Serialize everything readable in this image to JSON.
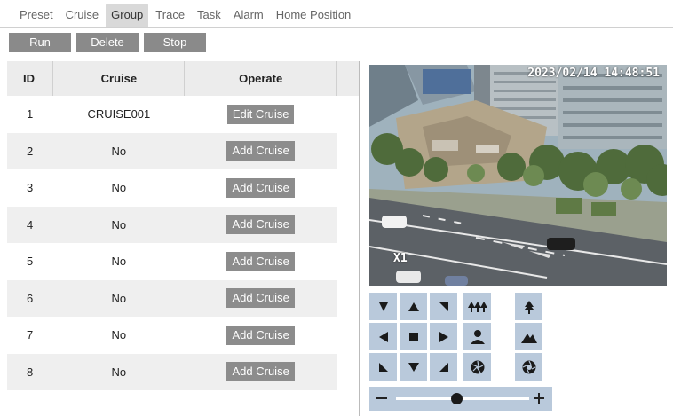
{
  "tabs": [
    {
      "label": "Preset"
    },
    {
      "label": "Cruise"
    },
    {
      "label": "Group",
      "active": true
    },
    {
      "label": "Trace"
    },
    {
      "label": "Task"
    },
    {
      "label": "Alarm"
    },
    {
      "label": "Home Position"
    }
  ],
  "toolbar": {
    "run": "Run",
    "delete": "Delete",
    "stop": "Stop"
  },
  "table": {
    "headers": {
      "id": "ID",
      "cruise": "Cruise",
      "operate": "Operate"
    },
    "rows": [
      {
        "id": "1",
        "cruise": "CRUISE001",
        "action": "Edit Cruise"
      },
      {
        "id": "2",
        "cruise": "No",
        "action": "Add Cruise"
      },
      {
        "id": "3",
        "cruise": "No",
        "action": "Add Cruise"
      },
      {
        "id": "4",
        "cruise": "No",
        "action": "Add Cruise"
      },
      {
        "id": "5",
        "cruise": "No",
        "action": "Add Cruise"
      },
      {
        "id": "6",
        "cruise": "No",
        "action": "Add Cruise"
      },
      {
        "id": "7",
        "cruise": "No",
        "action": "Add Cruise"
      },
      {
        "id": "8",
        "cruise": "No",
        "action": "Add Cruise"
      }
    ]
  },
  "video": {
    "timestamp": "2023/02/14 14:48:51",
    "zoom": "X1"
  },
  "ptz": {
    "directions": [
      "up-left",
      "up",
      "up-right",
      "left",
      "stop",
      "right",
      "down-left",
      "down",
      "down-right"
    ],
    "lens_controls": [
      "zoom-out",
      "zoom-in",
      "focus-near",
      "focus-far",
      "iris-close",
      "iris-open"
    ],
    "speed_fraction": 0.45
  },
  "colors": {
    "button_gray": "#8a8a8a",
    "ptz_button": "#b9c9db",
    "alt_row": "#efefef"
  }
}
